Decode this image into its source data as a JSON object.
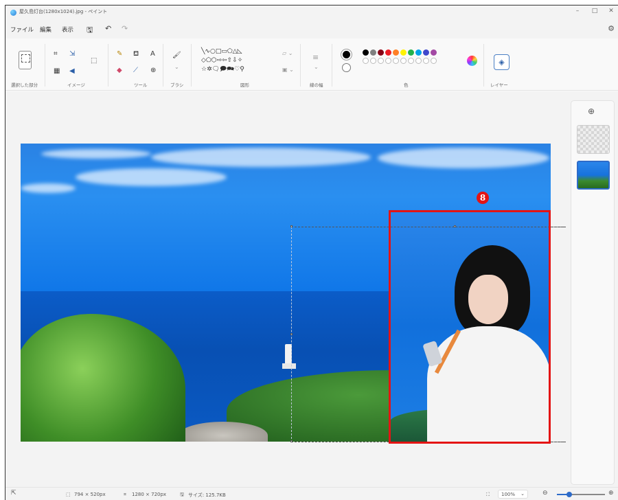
{
  "window": {
    "title": "屋久島灯台(1280x1024).jpg - ペイント",
    "minimize": "–",
    "maximize": "□",
    "close": "✕"
  },
  "menu": {
    "file": "ファイル",
    "edit": "編集",
    "view": "表示",
    "save_icon": "🖫",
    "undo_icon": "↶",
    "redo_icon": "↷",
    "settings_icon": "⚙"
  },
  "ribbon": {
    "groups": {
      "selection": "選択した部分",
      "image": "イメージ",
      "tools": "ツール",
      "brush": "ブラシ",
      "shapes": "図形",
      "line_width": "線の幅",
      "colors": "色",
      "layers": "レイヤー"
    },
    "shape_rows": [
      "╲∿○□▭⬠△◺",
      "◇⬠⬡⇨⇦⇧⇩✧",
      "☆✲🗨🗩🗪♡⚲"
    ],
    "swatch_row1": [
      "#000000",
      "#7f7f7f",
      "#880015",
      "#ed1c24",
      "#ff7f27",
      "#fff200",
      "#22b14c",
      "#00a2e8",
      "#3f48cc",
      "#a349a4",
      "#b97a57",
      "#c3c3c3"
    ],
    "swatch_row1_visible": 10
  },
  "colors": {
    "accent": "#2d6bc9",
    "highlight": "#e41414"
  },
  "annotation": {
    "badge_number": "8"
  },
  "status": {
    "selection_size": "794 × 520px",
    "image_size": "1280 × 720px",
    "file_size": "サイズ: 125.7KB",
    "zoom": "100%",
    "zoom_level_fraction": 0.25
  }
}
